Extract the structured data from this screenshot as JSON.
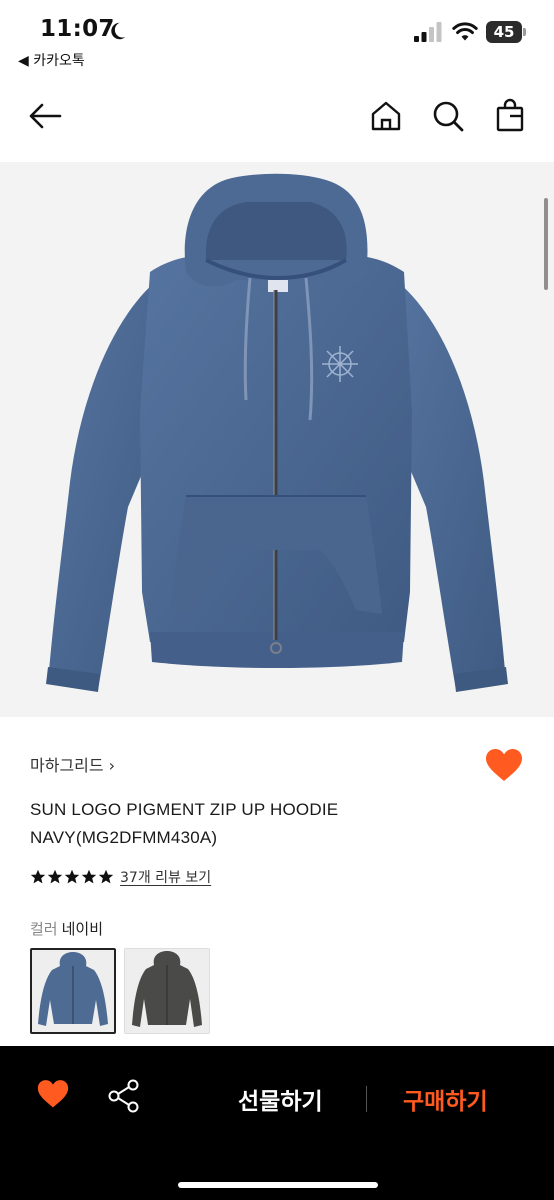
{
  "status_bar": {
    "time": "11:07",
    "back_app": "◀ 카카오톡",
    "battery": "45"
  },
  "nav": {
    "icons": [
      "back-arrow-icon",
      "home-icon",
      "search-icon",
      "shopping-bag-icon"
    ]
  },
  "product": {
    "brand": "마하그리드 ›",
    "name": "SUN LOGO PIGMENT ZIP UP HOODIE NAVY(MG2DFMM430A)",
    "rating_stars": 5,
    "review_link": "37개 리뷰 보기",
    "color_label": "컬러",
    "color_value": "네이비",
    "color_options": [
      "navy",
      "charcoal"
    ]
  },
  "bottom_bar": {
    "gift": "선물하기",
    "buy": "구매하기"
  },
  "colors": {
    "accent": "#ff5a1f",
    "hoodie_navy": "#4a6790",
    "hoodie_charcoal": "#4a4a48",
    "bottom_bar_bg": "#000000"
  }
}
